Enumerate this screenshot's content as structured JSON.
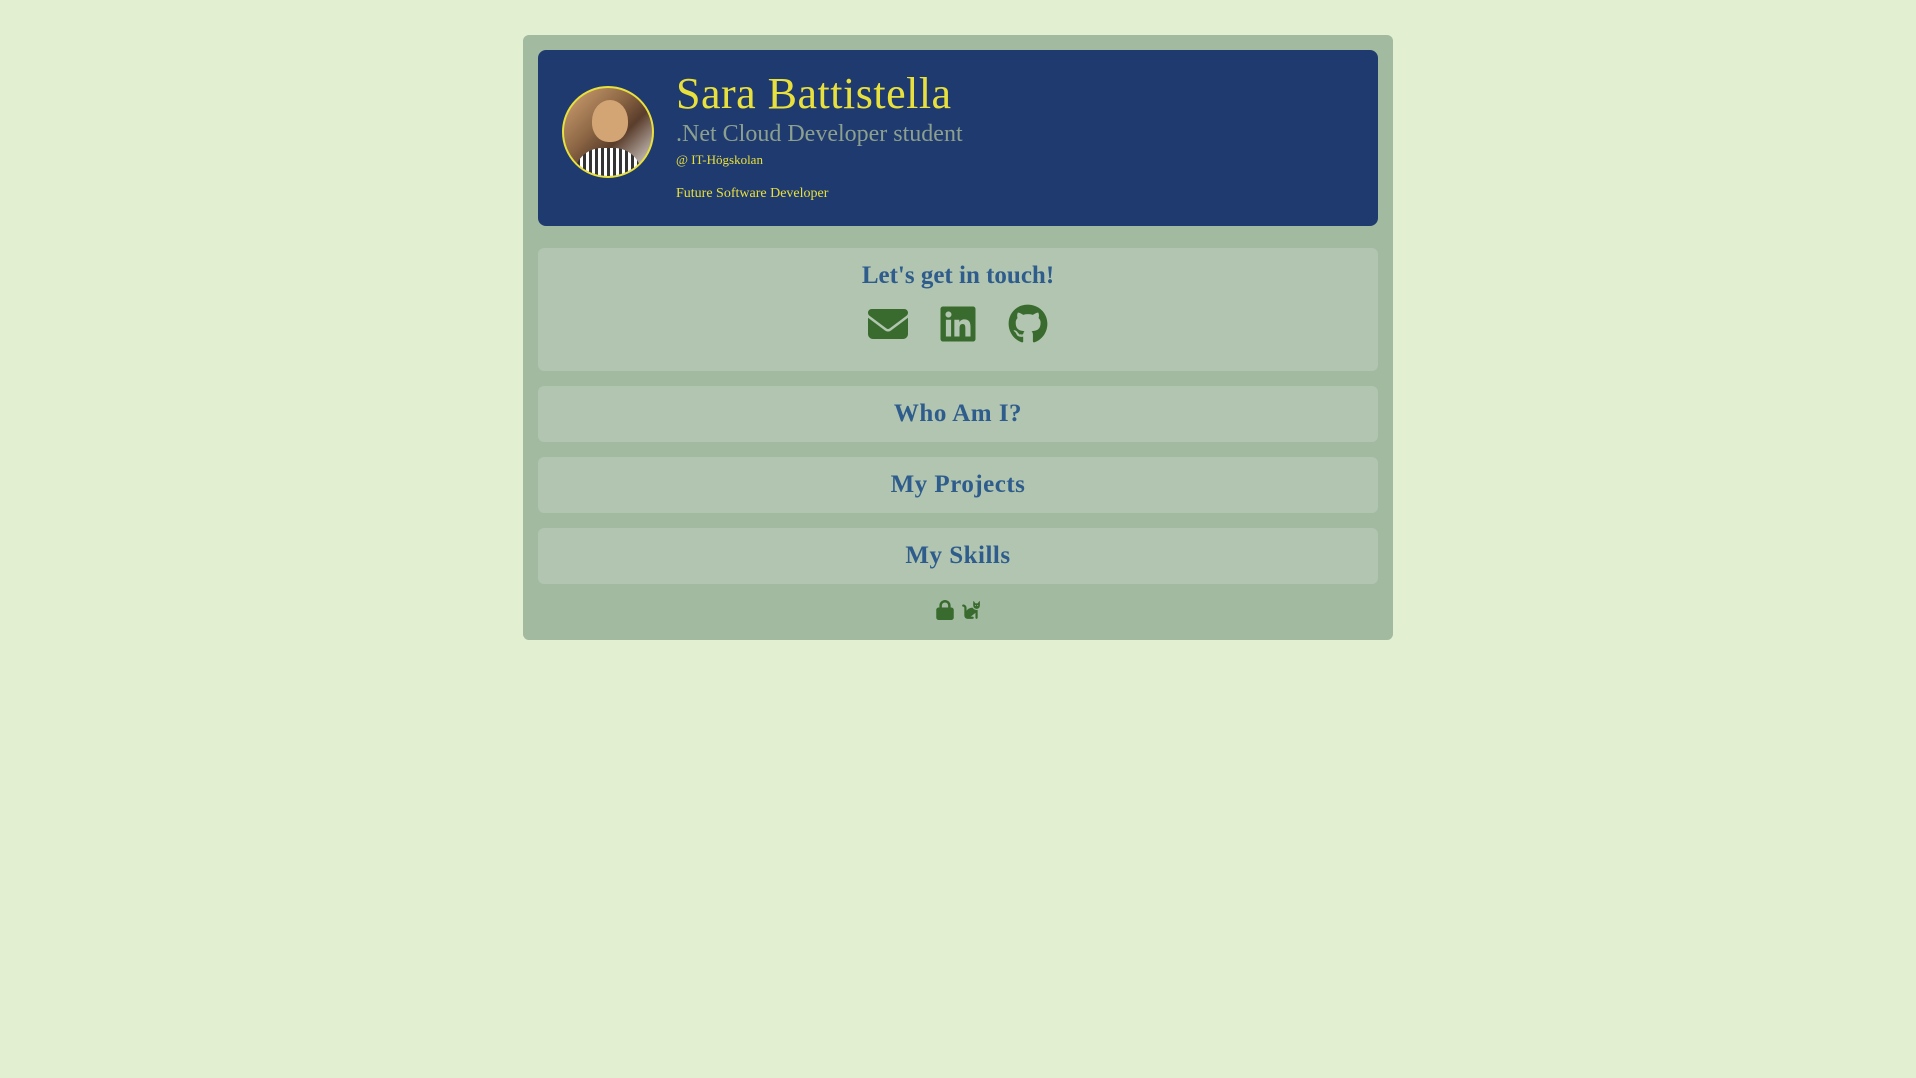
{
  "header": {
    "name": "Sara Battistella",
    "subtitle": ".Net Cloud Developer student",
    "school": "@ IT-Högskolan",
    "tagline": "Future Software Developer"
  },
  "contact": {
    "title": "Let's get in touch!",
    "icons": {
      "email": "email-icon",
      "linkedin": "linkedin-icon",
      "github": "github-icon"
    }
  },
  "sections": {
    "who": "Who Am I?",
    "projects": "My Projects",
    "skills": "My Skills"
  },
  "footer": {
    "lock": "lock-icon",
    "cat": "cat-icon"
  }
}
